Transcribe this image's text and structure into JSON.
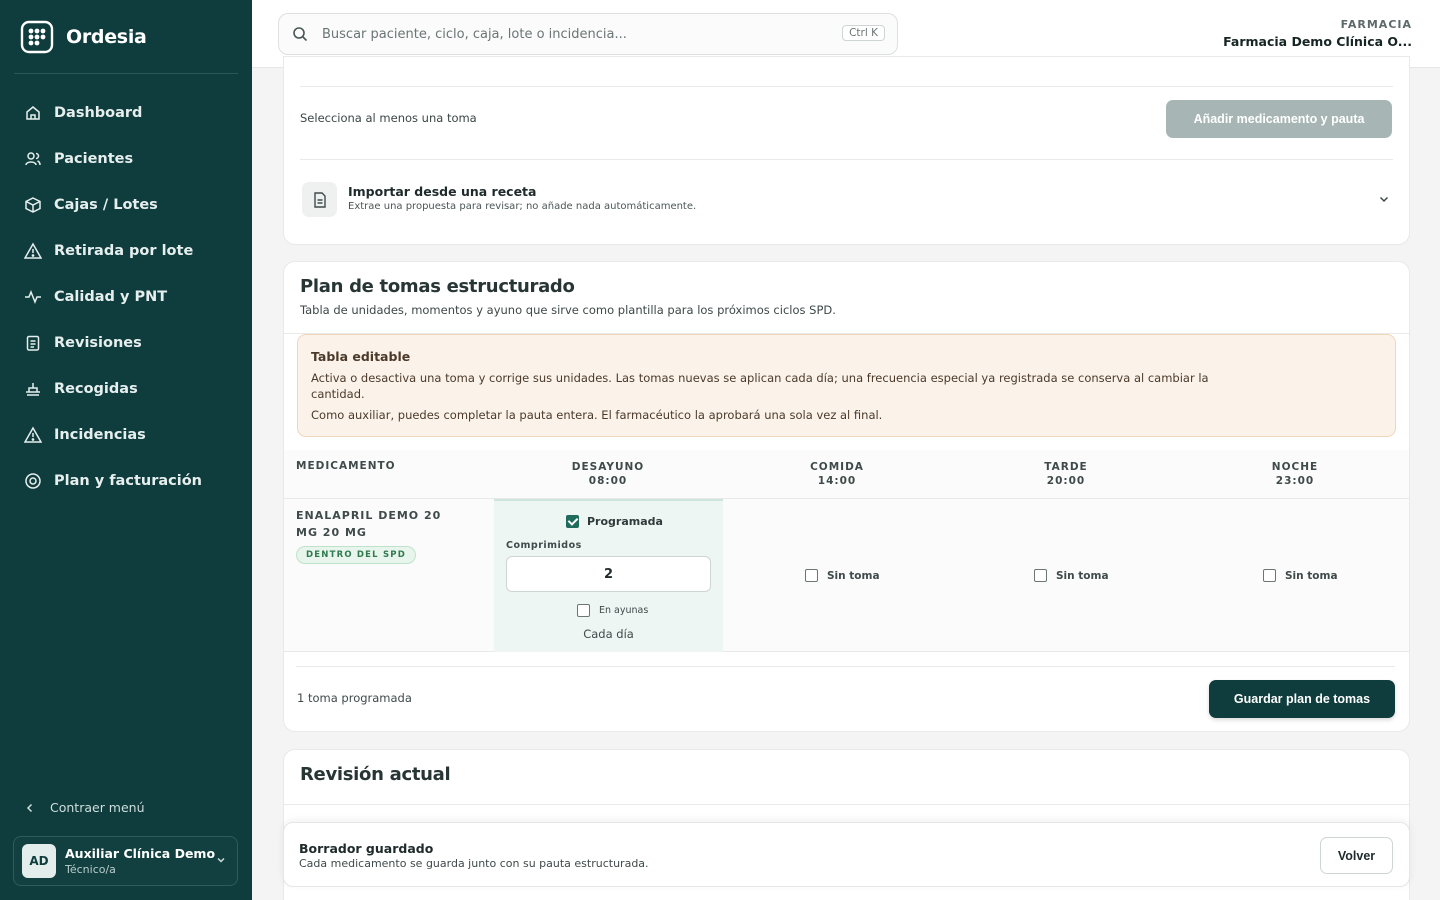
{
  "app": {
    "name": "Ordesia"
  },
  "sidebar": {
    "items": [
      {
        "label": "Dashboard",
        "icon": "home-icon"
      },
      {
        "label": "Pacientes",
        "icon": "users-icon"
      },
      {
        "label": "Cajas / Lotes",
        "icon": "box-icon"
      },
      {
        "label": "Retirada por lote",
        "icon": "warning-icon"
      },
      {
        "label": "Calidad y PNT",
        "icon": "activity-icon"
      },
      {
        "label": "Revisiones",
        "icon": "clipboard-icon"
      },
      {
        "label": "Recogidas",
        "icon": "pickup-icon"
      },
      {
        "label": "Incidencias",
        "icon": "alert-icon"
      },
      {
        "label": "Plan y facturación",
        "icon": "settings-icon"
      }
    ],
    "collapse_label": "Contraer menú",
    "user": {
      "initials": "AD",
      "name": "Auxiliar Clínica Demo",
      "role": "Técnico/a"
    }
  },
  "topbar": {
    "search_placeholder": "Buscar paciente, ciclo, caja, lote o incidencia...",
    "shortcut": "Ctrl K",
    "pharmacy_label": "FARMACIA",
    "pharmacy_name": "Farmacia Demo Clínica O..."
  },
  "add_section": {
    "hint": "Selecciona al menos una toma",
    "add_button": "Añadir medicamento y pauta",
    "import_title": "Importar desde una receta",
    "import_subtitle": "Extrae una propuesta para revisar; no añade nada automáticamente."
  },
  "plan": {
    "title": "Plan de tomas estructurado",
    "subtitle": "Tabla de unidades, momentos y ayuno que sirve como plantilla para los próximos ciclos SPD.",
    "notice": {
      "title": "Tabla editable",
      "text1": "Activa o desactiva una toma y corrige sus unidades. Las tomas nuevas se aplican cada día; una frecuencia especial ya registrada se conserva al cambiar la cantidad.",
      "text2": "Como auxiliar, puedes completar la pauta entera. El farmacéutico la aprobará una sola vez al final."
    },
    "columns": {
      "medication": "MEDICAMENTO",
      "slots": [
        {
          "name": "DESAYUNO",
          "time": "08:00"
        },
        {
          "name": "COMIDA",
          "time": "14:00"
        },
        {
          "name": "TARDE",
          "time": "20:00"
        },
        {
          "name": "NOCHE",
          "time": "23:00"
        }
      ]
    },
    "row": {
      "medication": "ENALAPRIL DEMO 20 MG 20 MG",
      "badge": "DENTRO DEL SPD",
      "breakfast": {
        "programmed_label": "Programada",
        "units_label": "Comprimidos",
        "units_value": "2",
        "fasting_label": "En ayunas",
        "frequency": "Cada día"
      },
      "off_label": "Sin toma"
    },
    "count": "1 toma programada",
    "save_button": "Guardar plan de tomas"
  },
  "review": {
    "title": "Revisión actual"
  },
  "toast": {
    "title": "Borrador guardado",
    "subtitle": "Cada medicamento se guarda junto con su pauta estructurada.",
    "back_button": "Volver"
  },
  "colors": {
    "sidebar": "#0f3c3c",
    "accent": "#1f6b5c",
    "notice_bg": "#fbf3ea",
    "badge": "#2f7a4e"
  }
}
